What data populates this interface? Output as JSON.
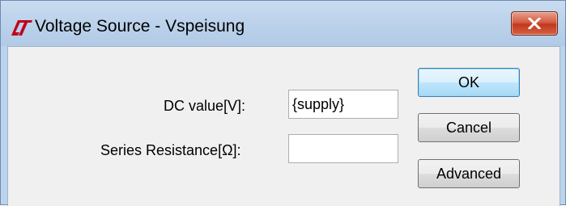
{
  "window": {
    "title": "Voltage Source - Vspeisung",
    "app_icon": "ltspice-logo-icon",
    "close_icon": "close-icon"
  },
  "form": {
    "dc_value_label": "DC value[V]:",
    "dc_value": "{supply}",
    "series_resistance_label": "Series Resistance[Ω]:",
    "series_resistance_value": ""
  },
  "buttons": {
    "ok_label": "OK",
    "cancel_label": "Cancel",
    "advanced_label": "Advanced"
  },
  "colors": {
    "titlebar": "#bad1ea",
    "close_button": "#c1391f",
    "client_background": "#f0f0f0",
    "logo": "#c0001a"
  }
}
